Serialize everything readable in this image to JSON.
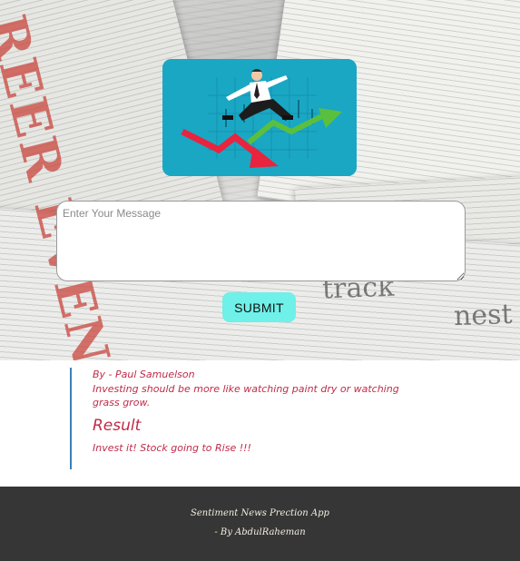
{
  "hero": {
    "headline_fragment": "REER EVENT.",
    "paper_word_1": "track",
    "paper_word_2": "nest"
  },
  "form": {
    "message_placeholder": "Enter Your Message",
    "message_value": "",
    "submit_label": "SUBMIT"
  },
  "quote": {
    "author": "By - Paul Samuelson",
    "text": "Investing should be more like watching paint dry or watching grass grow."
  },
  "result": {
    "heading": "Result",
    "value": "Invest it! Stock going to Rise !!!"
  },
  "footer": {
    "line1": "Sentiment News Prection App",
    "line2": "- By AbdulRaheman"
  },
  "colors": {
    "accent_text": "#c02a48",
    "submit_bg": "#6ff0e8",
    "card_bg": "#1aa7c4",
    "footer_bg": "#363636",
    "quote_border": "#3b7fb8"
  },
  "icons": {
    "hero_illustration": "businessman-jumping-over-trend-arrows"
  }
}
